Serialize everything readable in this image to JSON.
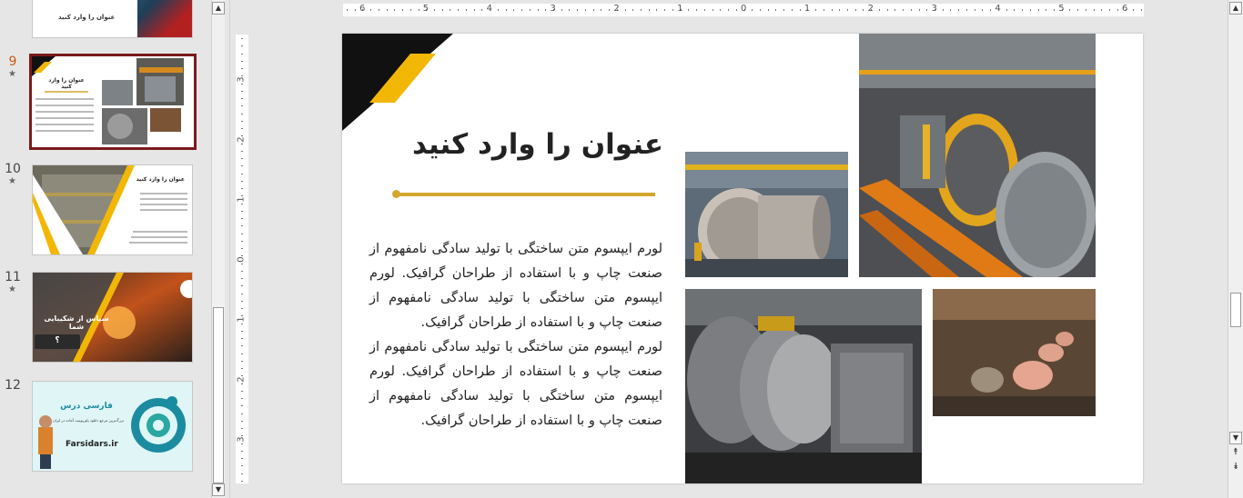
{
  "thumbnails": [
    {
      "number": "",
      "title": "عنوان را وارد کنید",
      "star": false,
      "selected": false
    },
    {
      "number": "9",
      "title": "عنوان را وارد کنید",
      "star": true,
      "selected": true
    },
    {
      "number": "10",
      "title": "عنوان را وارد کنید",
      "star": true,
      "selected": false
    },
    {
      "number": "11",
      "title": "سپاس از شکیبایی شما",
      "button": "؟",
      "star": true,
      "selected": false
    },
    {
      "number": "12",
      "brand": "فارسی درس",
      "tagline": "بزرگ‌ترین مرجع دانلود پاورپوینت آماده در ایران",
      "site": "Farsidars.ir",
      "star": false,
      "selected": false
    }
  ],
  "ruler": {
    "horizontal_labels": [
      "6",
      "5",
      "4",
      "3",
      "2",
      "1",
      "0",
      "1",
      "2",
      "3",
      "4",
      "5",
      "6"
    ],
    "vertical_labels": [
      "3",
      "2",
      "1",
      "0",
      "1",
      "2",
      "3"
    ]
  },
  "slide": {
    "title": "عنوان را وارد کنید",
    "paragraphs": [
      "لورم ایپسوم متن ساختگی با تولید سادگی نامفهوم از صنعت چاپ و با استفاده از طراحان گرافیک. لورم ایپسوم متن ساختگی با تولید سادگی نامفهوم از صنعت چاپ و با استفاده از طراحان گرافیک.",
      "لورم ایپسوم متن ساختگی با تولید سادگی نامفهوم از صنعت چاپ و با استفاده از طراحان گرافیک. لورم ایپسوم متن ساختگی با تولید سادگی نامفهوم از صنعت چاپ و با استفاده از طراحان گرافیک."
    ],
    "accent_color": "#d4a72c",
    "dark_color": "#111111",
    "yellow_color": "#f2b705"
  },
  "icons": {
    "scroll_up": "▲",
    "scroll_down": "▼",
    "prev_slide": "⯭",
    "next_slide": "⯯",
    "star": "★"
  }
}
